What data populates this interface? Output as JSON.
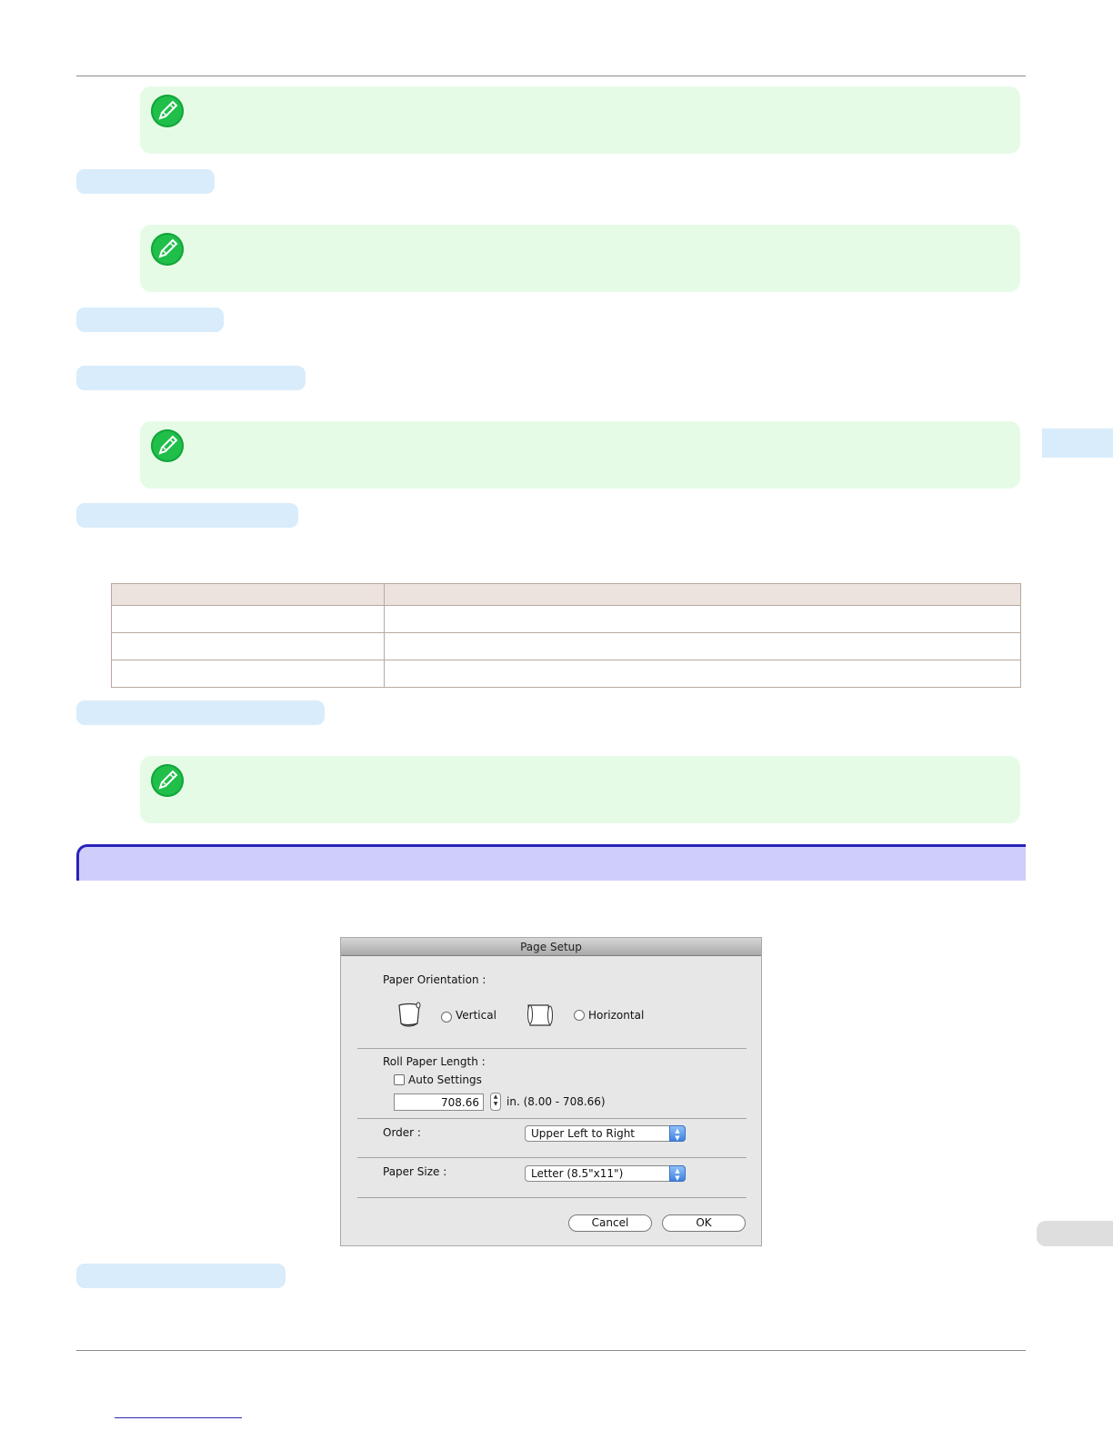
{
  "dialog": {
    "title": "Page Setup",
    "paper_orientation_label": "Paper Orientation :",
    "vertical_label": "Vertical",
    "horizontal_label": "Horizontal",
    "roll_paper_length_label": "Roll Paper Length :",
    "auto_settings_label": "Auto Settings",
    "length_value": "708.66",
    "length_range": "in. (8.00 - 708.66)",
    "order_label": "Order :",
    "order_value": "Upper Left to Right",
    "paper_size_label": "Paper Size :",
    "paper_size_value": "Letter (8.5\"x11\")",
    "cancel_label": "Cancel",
    "ok_label": "OK"
  },
  "colors": {
    "note_bg": "#e6fbe6",
    "note_icon": "#1fbf4a",
    "heading_pill": "#d8ecfb",
    "section_bar": "#cfcdfa",
    "section_border": "#2a23b8",
    "table_header": "#ece3de"
  },
  "icons": {
    "note": "pencil-note-icon"
  }
}
